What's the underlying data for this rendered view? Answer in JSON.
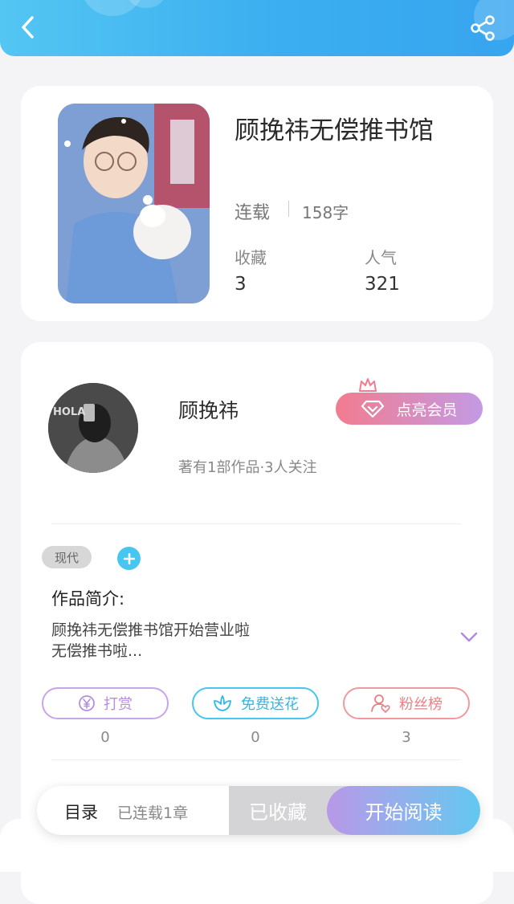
{
  "header": {
    "back_icon": "chevron-left-icon",
    "share_icon": "share-icon"
  },
  "book": {
    "title": "顾挽祎无偿推书馆",
    "status": "连载",
    "word_count": "158字",
    "collect_label": "收藏",
    "collect_value": "3",
    "popularity_label": "人气",
    "popularity_value": "321"
  },
  "author": {
    "name": "顾挽祎",
    "meta": "著有1部作品·3人关注",
    "vip_label": "点亮会员"
  },
  "tags": [
    "现代"
  ],
  "intro": {
    "title": "作品简介:",
    "line1": "顾挽祎无偿推书馆开始营业啦",
    "line2": "无偿推书啦..."
  },
  "actions": [
    {
      "label": "打赏",
      "count": "0",
      "icon": "yen-icon",
      "color": "#b48ee0"
    },
    {
      "label": "免费送花",
      "count": "0",
      "icon": "flower-icon",
      "color": "#47c6f2"
    },
    {
      "label": "粉丝榜",
      "count": "3",
      "icon": "fans-icon",
      "color": "#ef8a8e"
    }
  ],
  "bottom_bar": {
    "toc_label": "目录",
    "serial_label": "已连载1章",
    "collected_label": "已收藏",
    "read_label": "开始阅读"
  }
}
